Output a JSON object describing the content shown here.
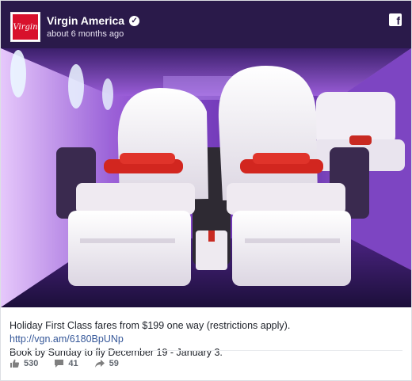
{
  "post": {
    "page_name": "Virgin America",
    "timestamp": "about 6 months ago",
    "avatar_text": "Virgin",
    "caption_text": "Holiday First Class fares from $199 one way (restrictions apply). ",
    "caption_link": "http://vgn.am/6180BpUNp",
    "caption_line2": "Book by Sunday to fly December 19 - January 3."
  },
  "stats": {
    "likes": "530",
    "comments": "41",
    "shares": "59"
  },
  "icons": {
    "facebook": "facebook-logo-icon",
    "verified": "verified-check-icon",
    "like": "thumbs-up-icon",
    "comment": "comment-bubble-icon",
    "share": "share-arrow-icon"
  },
  "colors": {
    "cabin_purple": "#7a3fb3",
    "seat_white": "#f4f1f4",
    "pillow_red": "#d2261f",
    "link": "#365899"
  }
}
